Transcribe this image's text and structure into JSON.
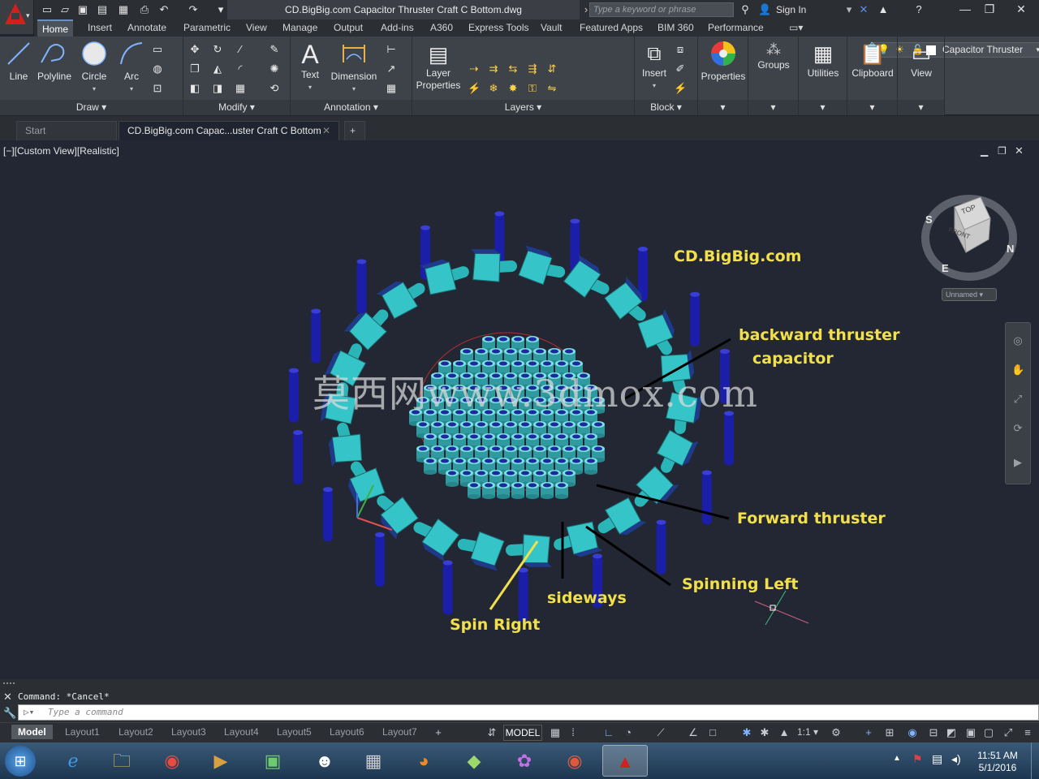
{
  "titlebar": {
    "doc_title": "CD.BigBig.com Capacitor Thruster Craft C Bottom.dwg",
    "search_placeholder": "Type a keyword or phrase",
    "signin_label": "Sign In"
  },
  "menu": {
    "tabs": [
      "Home",
      "Insert",
      "Annotate",
      "Parametric",
      "View",
      "Manage",
      "Output",
      "Add-ins",
      "A360",
      "Express Tools",
      "Vault",
      "Featured Apps",
      "BIM 360",
      "Performance"
    ],
    "active": "Home"
  },
  "ribbon": {
    "draw": {
      "label": "Draw",
      "line": "Line",
      "polyline": "Polyline",
      "circle": "Circle",
      "arc": "Arc"
    },
    "modify": {
      "label": "Modify"
    },
    "annotation": {
      "label": "Annotation",
      "text": "Text",
      "dimension": "Dimension"
    },
    "layers": {
      "label": "Layers",
      "layer_properties_1": "Layer",
      "layer_properties_2": "Properties",
      "current_layer": "Capacitor Thruster"
    },
    "block": {
      "label": "Block",
      "insert": "Insert"
    },
    "properties": "Properties",
    "groups": "Groups",
    "utilities": "Utilities",
    "clipboard": "Clipboard",
    "view": "View"
  },
  "filetabs": {
    "start": "Start",
    "drawing": "CD.BigBig.com Capac...uster Craft C Bottom"
  },
  "viewport": {
    "label": "[−][Custom View][Realistic]",
    "viewcube_top": "TOP",
    "viewcube_front": "FRONT",
    "compass_s": "S",
    "compass_n": "N",
    "compass_e": "E",
    "ucs_name": "Unnamed",
    "watermark": "莫西网www.3dmox.com",
    "annotations": {
      "site": "CD.BigBig.com",
      "backward_1": "backward thruster",
      "backward_2": "capacitor",
      "forward": "Forward thruster",
      "spinning_left": "Spinning  Left",
      "sideways": "sideways",
      "spin_right": "Spin Right"
    }
  },
  "command": {
    "history": "Command: *Cancel*",
    "placeholder": "Type a command"
  },
  "status": {
    "layouts": [
      "Model",
      "Layout1",
      "Layout2",
      "Layout3",
      "Layout4",
      "Layout5",
      "Layout6",
      "Layout7"
    ],
    "active_layout": "Model",
    "space": "MODEL",
    "scale": "1:1"
  },
  "taskbar": {
    "time": "11:51 AM",
    "date": "5/1/2016"
  },
  "colors": {
    "accent_red": "#d21f1f",
    "annotation_yellow": "#f2e04a",
    "thruster_cyan": "#2ab5b8",
    "post_blue": "#1a1ea8"
  }
}
